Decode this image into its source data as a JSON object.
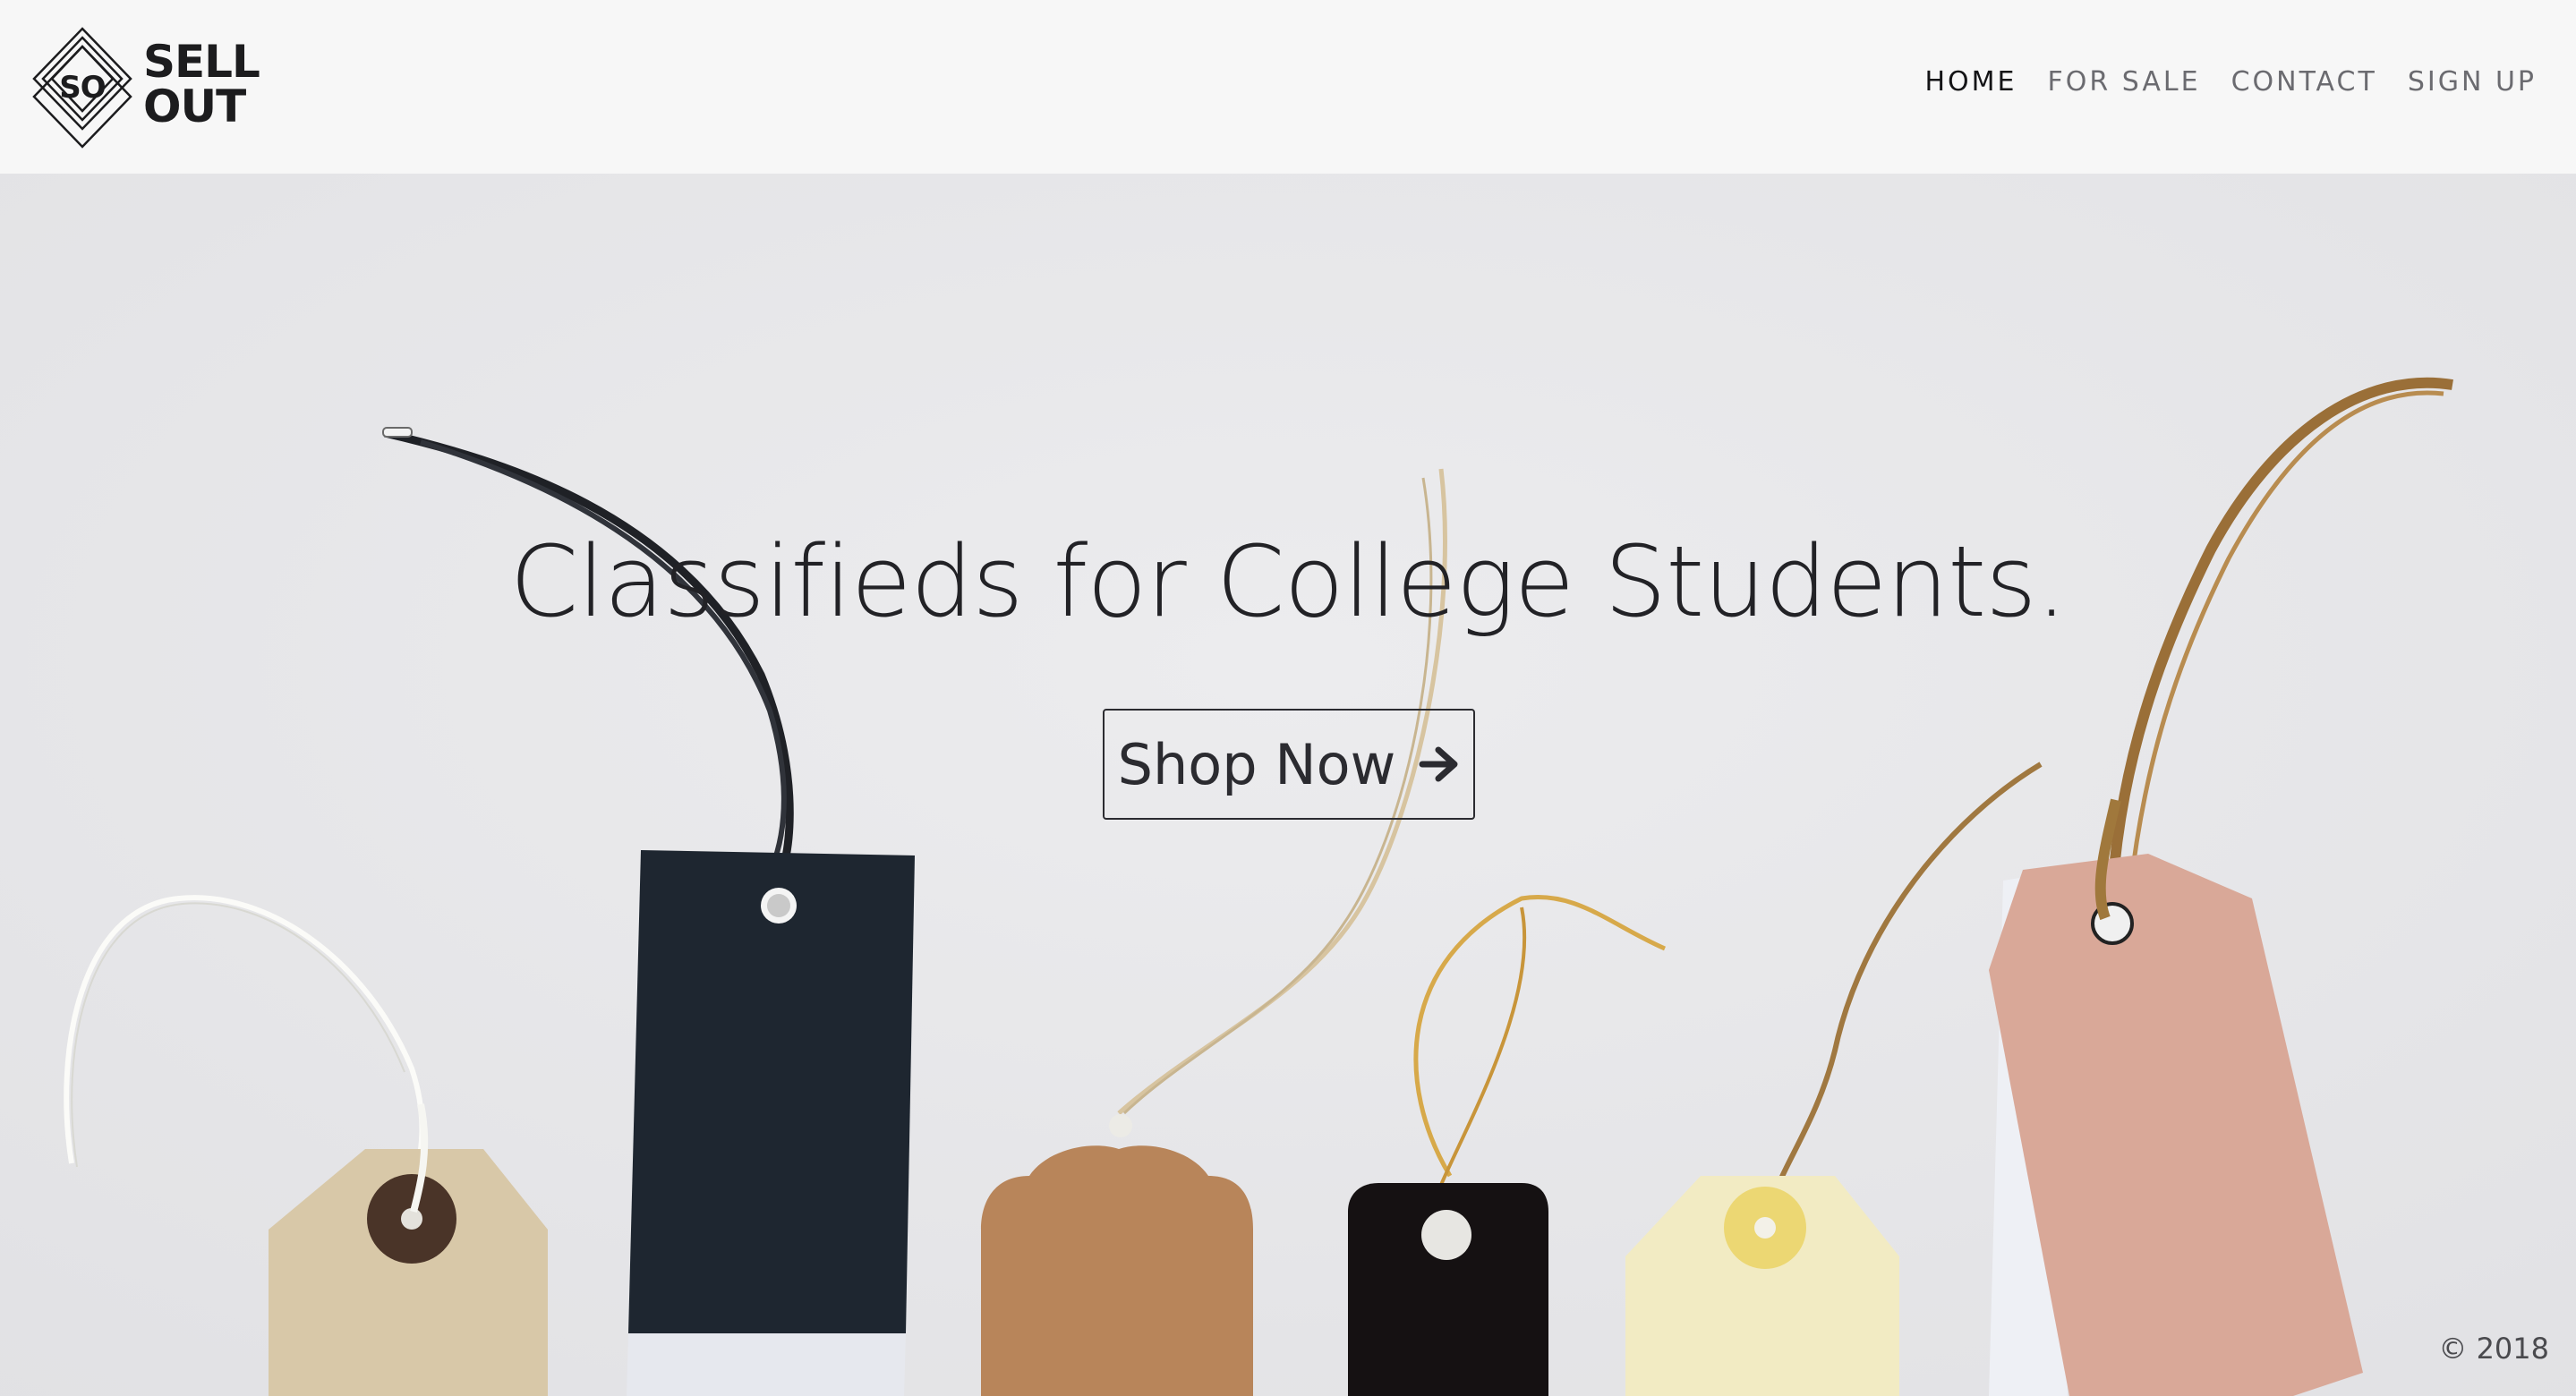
{
  "brand": {
    "mark": "SO",
    "line1": "SELL",
    "line2": "OUT"
  },
  "nav": {
    "items": [
      {
        "label": "HOME",
        "active": true
      },
      {
        "label": "FOR SALE",
        "active": false
      },
      {
        "label": "CONTACT",
        "active": false
      },
      {
        "label": "SIGN UP",
        "active": false
      }
    ]
  },
  "hero": {
    "headline": "Classifieds for College Students.",
    "cta_label": "Shop Now",
    "cta_icon": "arrow-right-icon",
    "image": "price-tags-photo"
  },
  "footer": {
    "copyright": "© 2018"
  },
  "colors": {
    "header_bg": "#f7f7f7",
    "hero_bg": "#e9e9eb",
    "text_dark": "#222226",
    "nav_inactive": "#6b6b70"
  }
}
